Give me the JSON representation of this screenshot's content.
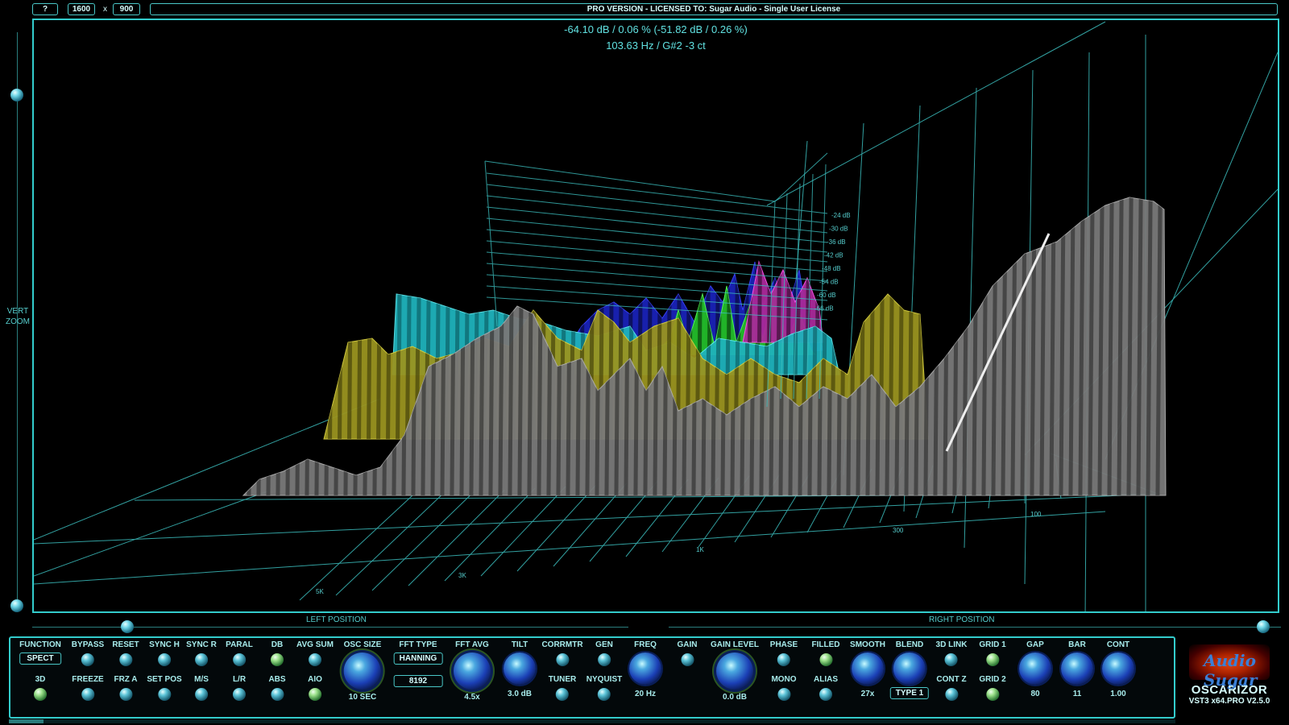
{
  "top": {
    "help_label": "?",
    "width_value": "1600",
    "x_sep": "x",
    "height_value": "900",
    "license": "PRO VERSION - LICENSED TO: Sugar Audio - Single User License"
  },
  "readout": {
    "line1": "-64.10 dB / 0.06 % (-51.82 dB / 0.26 %)",
    "line2": "103.63 Hz / G#2 -3 ct"
  },
  "display": {
    "db_labels": [
      "-24 dB",
      "-30 dB",
      "-36 dB",
      "-42 dB",
      "-48 dB",
      "-54 dB",
      "-60 dB",
      "-66 dB"
    ],
    "freq_labels": [
      "5K",
      "3K",
      "1K",
      "300",
      "100"
    ],
    "colors": {
      "grid": "#3bbcbc",
      "cyan": "#1fb3bc",
      "yellow": "#9a9420",
      "gray": "#7a7a7a",
      "blue": "#1a22b8",
      "green": "#22bb22",
      "magenta": "#aa2a9a"
    }
  },
  "sliders": {
    "vert_zoom": "VERT\nZOOM",
    "left_position": "LEFT POSITION",
    "right_position": "RIGHT POSITION"
  },
  "controls": {
    "function": "FUNCTION",
    "function_value": "SPECT",
    "mode_3d": "3D",
    "bypass": "BYPASS",
    "freeze": "FREEZE",
    "reset": "RESET",
    "frz_a": "FRZ A",
    "sync_h": "SYNC H",
    "set_pos": "SET POS",
    "sync_r": "SYNC R",
    "ms": "M/S",
    "paral": "PARAL",
    "lr": "L/R",
    "db": "DB",
    "abs": "ABS",
    "avg_sum": "AVG SUM",
    "aio": "AIO",
    "osc_size": "OSC SIZE",
    "osc_size_value": "10 SEC",
    "fft_type": "FFT TYPE",
    "fft_type_value": "HANNING",
    "fft_size_value": "8192",
    "fft_avg": "FFT AVG",
    "fft_avg_value": "4.5x",
    "tilt": "TILT",
    "tilt_value": "3.0 dB",
    "corrmtr": "CORRMTR",
    "tuner": "TUNER",
    "gen": "GEN",
    "nyquist": "NYQUIST",
    "freq": "FREQ",
    "freq_value": "20 Hz",
    "gain": "GAIN",
    "gain_level": "GAIN LEVEL",
    "gain_level_value": "0.0 dB",
    "phase": "PHASE",
    "mono": "MONO",
    "filled": "FILLED",
    "alias": "ALIAS",
    "smooth": "SMOOTH",
    "smooth_value": "27x",
    "blend": "BLEND",
    "blend_value": "TYPE 1",
    "link_3d": "3D LINK",
    "cont_z": "CONT Z",
    "grid1": "GRID 1",
    "grid2": "GRID 2",
    "gap": "GAP",
    "gap_value": "80",
    "bar": "BAR",
    "bar_value": "11",
    "cont": "CONT",
    "cont_value": "1.00"
  },
  "brand": {
    "logo_text": "Audio Sugar",
    "product": "OSCARIZOR",
    "version": "VST3 x64.PRO V2.5.0"
  },
  "progress": 0.03
}
